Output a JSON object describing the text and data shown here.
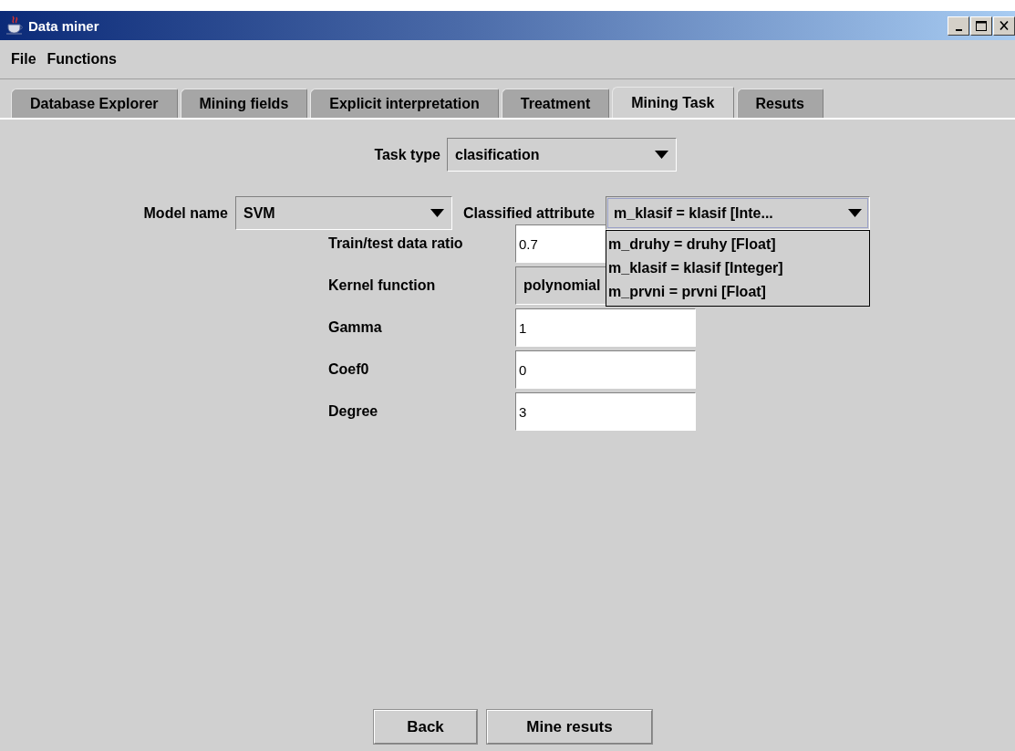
{
  "window": {
    "title": "Data miner"
  },
  "menu": [
    {
      "label": "File"
    },
    {
      "label": "Functions"
    }
  ],
  "tabs": [
    {
      "label": "Database Explorer",
      "selected": false
    },
    {
      "label": "Mining fields",
      "selected": false
    },
    {
      "label": "Explicit interpretation",
      "selected": false
    },
    {
      "label": "Treatment",
      "selected": false
    },
    {
      "label": "Mining Task",
      "selected": true
    },
    {
      "label": "Resuts",
      "selected": false
    }
  ],
  "task_type": {
    "label": "Task type",
    "value": "clasification"
  },
  "model_name": {
    "label": "Model name",
    "value": "SVM"
  },
  "classified_attribute": {
    "label": "Classified attribute",
    "value": "m_klasif = klasif [Inte...",
    "expanded": true,
    "options": [
      {
        "label": "m_druhy = druhy [Float]",
        "selected": false
      },
      {
        "label": "m_klasif = klasif [Integer]",
        "selected": false
      },
      {
        "label": "m_prvni = prvni [Float]",
        "selected": false
      }
    ]
  },
  "parameters": [
    {
      "kind": "text",
      "label": "Train/test data ratio",
      "value": "0.7"
    },
    {
      "kind": "dropdown",
      "label": "Kernel function",
      "value": "polynomial"
    },
    {
      "kind": "text",
      "label": "Gamma",
      "value": "1"
    },
    {
      "kind": "text",
      "label": "Coef0",
      "value": "0"
    },
    {
      "kind": "text",
      "label": "Degree",
      "value": "3"
    }
  ],
  "buttons": [
    {
      "label": "Back"
    },
    {
      "label": "Mine resuts"
    }
  ]
}
